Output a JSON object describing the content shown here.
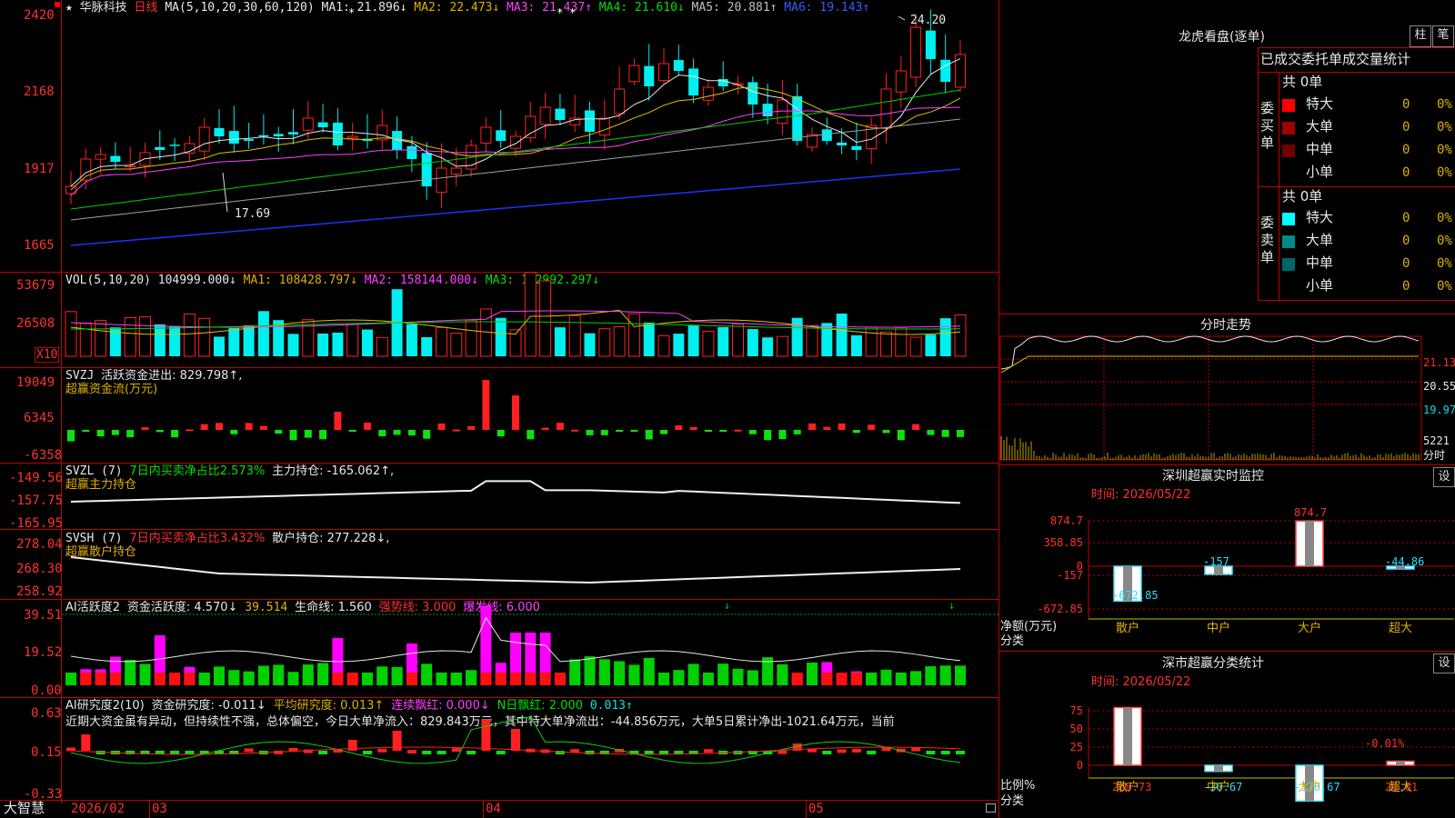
{
  "app": {
    "brand": "大智慧"
  },
  "main": {
    "header": {
      "star": "★",
      "stock_name": "华脉科技",
      "period": "日线",
      "ma_def": "MA(5,10,20,30,60,120)",
      "ma1": "MA1: 21.896↓",
      "ma2": "MA2: 22.473↓",
      "ma3": "MA3: 21.437↑",
      "ma4": "MA4: 21.610↓",
      "ma5": "MA5: 20.881↑",
      "ma6": "MA6: 19.143↑"
    },
    "y_ticks": [
      "2420",
      "2168",
      "1917",
      "1665"
    ],
    "annot_high": "24.20",
    "annot_low": "17.69",
    "colors": {
      "up": "#ff2020",
      "down": "#00f0f0",
      "ma_white": "#e8e8e8",
      "ma_yellow": "#e0c000",
      "ma_magenta": "#ff40ff",
      "ma_green": "#00d000",
      "ma_gray": "#a0a0a0",
      "ma_blue": "#2030ff"
    }
  },
  "vol": {
    "header": {
      "def": "VOL(5,10,20)",
      "val": "104999.000↓",
      "ma1": "MA1: 108428.797↓",
      "ma2": "MA2: 158144.000↓",
      "ma3": "MA3: 142992.297↓"
    },
    "y_ticks": [
      "53679",
      "26508"
    ],
    "unit": "X10"
  },
  "svzj": {
    "header": {
      "name": "SVZJ",
      "text": "活跃资金进出: 829.798↑,",
      "sub": "超赢资金流(万元)"
    },
    "y_ticks": [
      "19049",
      "6345",
      "-6358"
    ]
  },
  "svzl": {
    "header": {
      "name": "SVZL (7)",
      "text1": "7日内买卖净占比2.573%",
      "text2": "主力持仓: -165.062↑,",
      "sub": "超赢主力持仓"
    },
    "y_ticks": [
      "-149.56",
      "-157.75",
      "-165.95"
    ]
  },
  "svsh": {
    "header": {
      "name": "SVSH (7)",
      "text1": "7日内买卖净占比3.432%",
      "text2": "散户持仓: 277.228↓,",
      "sub": "超赢散户持仓"
    },
    "y_ticks": [
      "278.04",
      "268.30",
      "258.92"
    ]
  },
  "ai1": {
    "header": {
      "name": "AI活跃度2",
      "t1": "资金活跃度: 4.570↓",
      "t2": "39.514",
      "t3": "生命线: 1.560",
      "t4": "强势线: 3.000",
      "t5": "爆发线: 6.000"
    },
    "y_ticks": [
      "39.51",
      "19.52",
      "0.00"
    ]
  },
  "ai2": {
    "header": {
      "name": "AI研究度2(10)",
      "t1": "资金研究度: -0.011↓",
      "t2": "平均研究度: 0.013↑",
      "t3": "连续飘红: 0.000↓",
      "t4": "N日飘红: 2.000",
      "t5": "0.013↑"
    },
    "comment": "近期大资金虽有异动，但持续性不强，总体偏空，今日大单净流入：829.843万元，其中特大单净流出：-44.856万元，大单5日累计净出-1021.64万元，当前",
    "y_ticks": [
      "0.63",
      "0.15",
      "-0.33"
    ]
  },
  "xaxis": {
    "labels": [
      "2026/02",
      "03",
      "04",
      "05"
    ]
  },
  "right": {
    "longhu": {
      "title": "龙虎看盘(逐单)",
      "btn1": "柱",
      "btn2": "笔"
    },
    "orders": {
      "tabs": [
        "已成交",
        "委托单",
        "成交量统计"
      ],
      "buy_label": "委买单",
      "sell_label": "委卖单",
      "buy_total": "共 0单",
      "sell_total": "共 0单",
      "buy_rows": [
        {
          "name": "特大",
          "count": "0",
          "pct": "0%",
          "color": "#ff0000"
        },
        {
          "name": "大单",
          "count": "0",
          "pct": "0%",
          "color": "#a00000"
        },
        {
          "name": "中单",
          "count": "0",
          "pct": "0%",
          "color": "#700000"
        },
        {
          "name": "小单",
          "count": "0",
          "pct": "0%",
          "color": "#000000"
        }
      ],
      "sell_rows": [
        {
          "name": "特大",
          "count": "0",
          "pct": "0%",
          "color": "#00ffff"
        },
        {
          "name": "大单",
          "count": "0",
          "pct": "0%",
          "color": "#008888"
        },
        {
          "name": "中单",
          "count": "0",
          "pct": "0%",
          "color": "#006666"
        },
        {
          "name": "小单",
          "count": "0",
          "pct": "0%",
          "color": "#000000"
        }
      ]
    },
    "fenshi": {
      "title": "分时走势",
      "y_ticks": [
        "21.13",
        "20.55",
        "19.97"
      ],
      "vol_tick": "5221",
      "vol_label": "分时"
    },
    "monitor": {
      "title": "深圳超赢实时监控",
      "btn": "设",
      "time": "时间: 2026/05/22",
      "y_ticks": [
        "874.7",
        "358.85",
        "0",
        "-157",
        "-672.85"
      ],
      "ylabel": "净额(万元)",
      "xlabel": "分类",
      "chart_data": {
        "type": "bar",
        "categories": [
          "散户",
          "中户",
          "大户",
          "超大"
        ],
        "values": [
          -672.85,
          -157,
          874.7,
          -44.86
        ],
        "labels": [
          "-672.85",
          "-157",
          "874.7",
          "-44.86"
        ]
      }
    },
    "classify": {
      "title": "深市超赢分类统计",
      "btn": "设",
      "time": "时间: 2026/05/22",
      "y_ticks": [
        "75",
        "50",
        "25",
        "0"
      ],
      "ylabel": "比例%",
      "xlabel": "分类",
      "chart_data": {
        "type": "bar",
        "categories": [
          "散户",
          "中户",
          "大户",
          "超大"
        ],
        "values": [
          288.73,
          -30.67,
          -178.67,
          20.61
        ],
        "labels": [
          "288.73",
          "-30.67",
          "-178.67",
          "20.61"
        ],
        "extra_label": "-0.01%"
      }
    }
  }
}
